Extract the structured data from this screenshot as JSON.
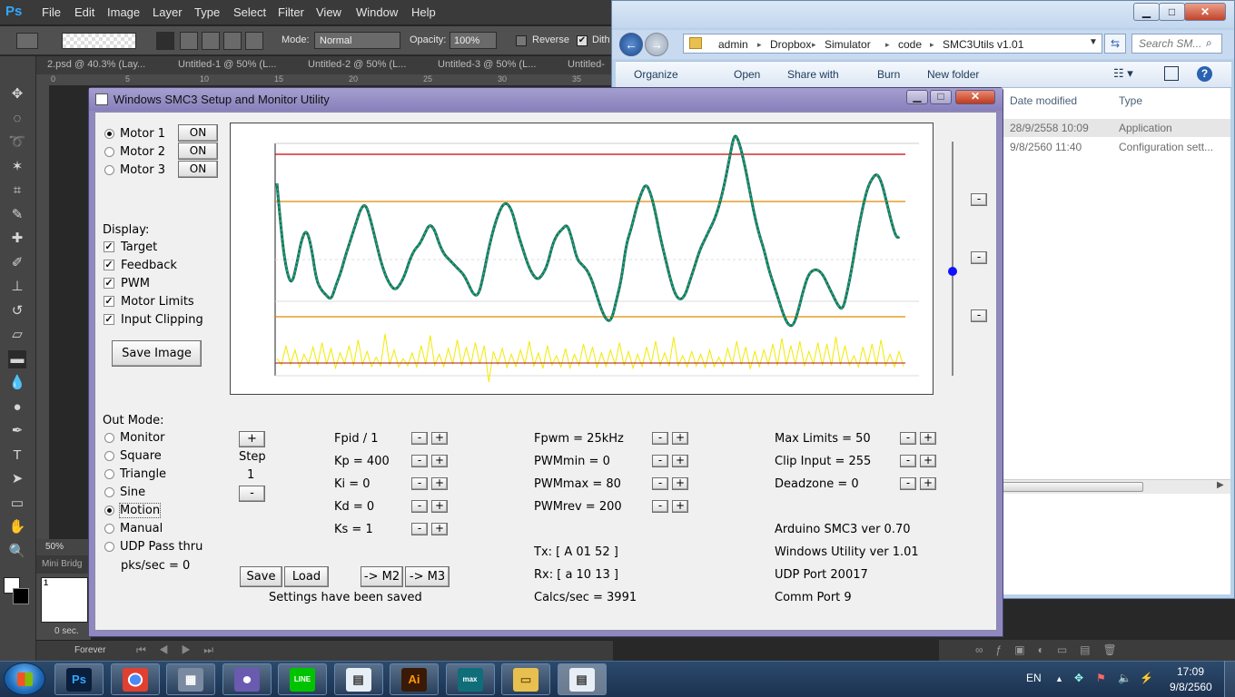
{
  "photoshop": {
    "logo": "Ps",
    "menu": [
      "File",
      "Edit",
      "Image",
      "Layer",
      "Type",
      "Select",
      "Filter",
      "View",
      "Window",
      "Help"
    ],
    "options": {
      "mode_label": "Mode:",
      "mode_value": "Normal",
      "opacity_label": "Opacity:",
      "opacity_value": "100%",
      "reverse_label": "Reverse",
      "dither_label": "Dith"
    },
    "tabs": [
      "2.psd @ 40.3% (Lay...",
      "Untitled-1 @ 50% (L...",
      "Untitled-2 @ 50% (L...",
      "Untitled-3 @ 50% (L...",
      "Untitled-"
    ],
    "ruler_ticks": [
      "0",
      "5",
      "10",
      "15",
      "20",
      "25",
      "30",
      "35"
    ],
    "zoom": "50%",
    "mini_bridge": "Mini Bridg",
    "layer_number": "1",
    "time_value": "0 sec.",
    "loop": "Forever"
  },
  "explorer": {
    "breadcrumbs": [
      "admin",
      "Dropbox",
      "Simulator",
      "code",
      "SMC3Utils v1.01"
    ],
    "search_placeholder": "Search SM...",
    "commands": [
      "Organize",
      "Open",
      "Share with",
      "Burn",
      "New folder"
    ],
    "columns": [
      "Date modified",
      "Type"
    ],
    "files": [
      {
        "date": "28/9/2558 10:09",
        "type": "Application"
      },
      {
        "date": "9/8/2560 11:40",
        "type": "Configuration sett..."
      }
    ]
  },
  "taskbar": {
    "language": "EN",
    "time": "17:09",
    "date": "9/8/2560",
    "apps": [
      "photoshop-app",
      "chrome-app",
      "calculator-app",
      "bittorrent-app",
      "line-app",
      "notepad-app",
      "illustrator-app",
      "3dsmax-app",
      "explorer-app",
      "smc3-app"
    ],
    "app_labels": {
      "ps": "Ps",
      "line": "LINE",
      "ai": "Ai",
      "max": "max"
    }
  },
  "smc3": {
    "title": "Windows SMC3 Setup and Monitor Utility",
    "motors": [
      {
        "label": "Motor 1",
        "state": "ON",
        "selected": true
      },
      {
        "label": "Motor 2",
        "state": "ON",
        "selected": false
      },
      {
        "label": "Motor 3",
        "state": "ON",
        "selected": false
      }
    ],
    "display_label": "Display:",
    "display_options": [
      {
        "label": "Target",
        "checked": true
      },
      {
        "label": "Feedback",
        "checked": true
      },
      {
        "label": "PWM",
        "checked": true
      },
      {
        "label": "Motor Limits",
        "checked": true
      },
      {
        "label": "Input Clipping",
        "checked": true
      }
    ],
    "save_image": "Save Image",
    "out_mode_label": "Out Mode:",
    "out_modes": [
      {
        "label": "Monitor",
        "selected": false
      },
      {
        "label": "Square",
        "selected": false
      },
      {
        "label": "Triangle",
        "selected": false
      },
      {
        "label": "Sine",
        "selected": false
      },
      {
        "label": "Motion",
        "selected": true
      },
      {
        "label": "Manual",
        "selected": false
      },
      {
        "label": "UDP Pass thru",
        "selected": false
      }
    ],
    "pks_sec": "pks/sec = 0",
    "step": {
      "label": "Step",
      "value": "1",
      "plus": "+",
      "minus": "-"
    },
    "pid_params": [
      "Fpid / 1",
      "Kp = 400",
      "Ki = 0",
      "Kd = 0",
      "Ks = 1"
    ],
    "pwm_params": [
      "Fpwm = 25kHz",
      "PWMmin = 0",
      "PWMmax = 80",
      "PWMrev = 200"
    ],
    "limit_params": [
      "Max Limits = 50",
      "Clip Input = 255",
      "Deadzone = 0"
    ],
    "tx": "Tx: [ A 01 52 ]",
    "rx": "Rx: [ a 10 13 ]",
    "calcs": "Calcs/sec = 3991",
    "versions": [
      "Arduino SMC3 ver 0.70",
      "Windows Utility ver 1.01",
      "UDP Port 20017",
      "Comm Port 9"
    ],
    "buttons": {
      "save": "Save",
      "load": "Load",
      "to_m2": "-> M2",
      "to_m3": "-> M3"
    },
    "status": "Settings have been saved",
    "spin_minus": "-",
    "spin_plus": "+",
    "slider_minus": "-"
  },
  "colors": {
    "motor_limit": "#cc0000",
    "clip_limit": "#e08a00",
    "target": "#00b0b0",
    "feedback": "#2a6a40",
    "pwm": "#f2ea00",
    "slider_knob": "#1010ff"
  },
  "motor_signal": {
    "target_samples": [
      30,
      8,
      -5,
      -10,
      -2,
      8,
      12,
      5,
      -8,
      -12,
      -14,
      -16,
      -10,
      -5,
      2,
      8,
      14,
      20,
      22,
      16,
      8,
      0,
      -6,
      -10,
      -12,
      -10,
      -6,
      0,
      4,
      6,
      10,
      14,
      12,
      6,
      2,
      0,
      -2,
      -4,
      -6,
      -10,
      -14,
      -14,
      -6,
      4,
      12,
      18,
      22,
      22,
      18,
      10,
      4,
      -2,
      -6,
      -8,
      -6,
      -2,
      6,
      10,
      12,
      14,
      8,
      0,
      -2,
      -4,
      -8,
      -14,
      -20,
      -24,
      -24,
      -16,
      -8,
      6,
      12,
      20,
      26,
      30,
      26,
      18,
      8,
      0,
      -8,
      -14,
      -16,
      -14,
      -8,
      -2,
      4,
      8,
      12,
      16,
      22,
      30,
      40,
      50,
      46,
      38,
      28,
      18,
      10,
      4,
      -4,
      -10,
      -16,
      -22,
      -26,
      -26,
      -20,
      -12,
      -6,
      -4,
      -4,
      -6,
      -10,
      -14,
      -18,
      -20,
      -12,
      -2,
      10,
      20,
      28,
      32,
      34,
      30,
      22,
      14,
      8,
      10
    ],
    "pwm_level": 5,
    "pwm_noise": [
      3,
      7,
      12,
      5,
      9,
      15,
      6,
      2,
      11,
      8,
      14,
      4,
      10,
      18,
      7,
      3,
      12,
      9,
      16,
      5,
      8,
      13,
      4,
      11,
      20,
      6,
      9,
      14,
      3,
      10,
      7,
      15,
      12,
      5,
      19,
      8,
      6,
      13,
      10,
      4,
      16,
      9,
      11,
      7,
      14,
      3,
      12,
      22,
      8,
      5,
      10,
      17,
      6,
      13,
      9,
      4,
      15,
      11,
      7,
      20,
      12,
      8,
      5,
      14,
      10,
      18,
      6,
      9,
      13,
      4,
      11,
      16,
      7,
      12,
      9,
      5,
      14,
      10,
      8,
      19,
      6,
      13,
      11,
      4,
      15,
      9,
      7,
      12,
      18,
      10,
      5,
      14,
      8,
      11,
      6,
      16,
      9,
      13,
      4,
      12,
      10,
      7,
      15,
      6,
      11,
      22,
      8,
      14,
      9,
      5,
      13,
      10,
      17,
      7,
      12,
      6,
      15,
      11,
      8,
      4,
      14,
      9,
      13,
      10,
      18,
      6,
      12,
      8,
      5,
      15,
      11,
      7,
      13,
      9,
      16,
      10,
      6,
      14,
      8,
      12
    ]
  }
}
